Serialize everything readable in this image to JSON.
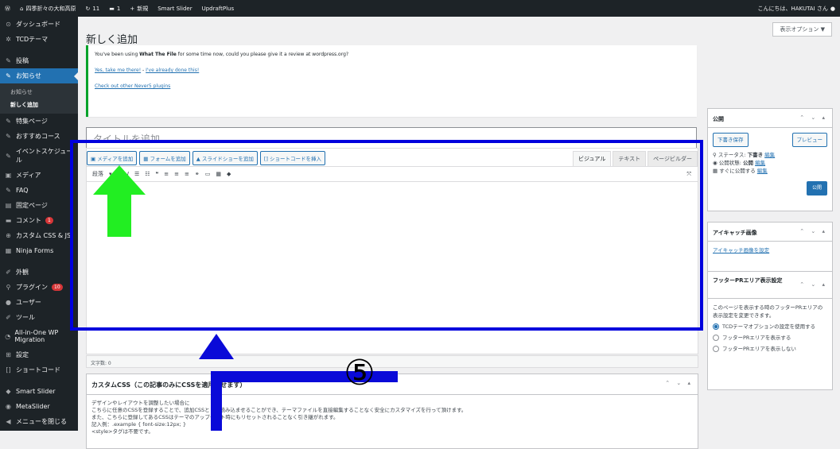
{
  "adminbar": {
    "site": "四季折々の大和高原",
    "comments": "11",
    "updates": "1",
    "new": "新規",
    "plugin1": "Smart Slider",
    "plugin2": "UpdraftPlus",
    "greeting": "こんにちは、HAKUTAI さん"
  },
  "sidebar": {
    "items": [
      {
        "label": "ダッシュボード",
        "icon": "dashboard-icon",
        "glyph": "⊙"
      },
      {
        "label": "TCDテーマ",
        "icon": "gear-icon",
        "glyph": "✲"
      },
      {
        "label": "投稿",
        "icon": "pin-icon",
        "glyph": "✎"
      },
      {
        "label": "お知らせ",
        "icon": "pin-icon",
        "glyph": "✎"
      },
      {
        "label": "特集ページ",
        "icon": "pin-icon",
        "glyph": "✎"
      },
      {
        "label": "おすすめコース",
        "icon": "pin-icon",
        "glyph": "✎"
      },
      {
        "label": "イベントスケジュール",
        "icon": "pin-icon",
        "glyph": "✎"
      },
      {
        "label": "メディア",
        "icon": "media-icon",
        "glyph": "▣"
      },
      {
        "label": "FAQ",
        "icon": "pin-icon",
        "glyph": "✎"
      },
      {
        "label": "固定ページ",
        "icon": "page-icon",
        "glyph": "▤"
      },
      {
        "label": "コメント",
        "icon": "comment-icon",
        "glyph": "▬",
        "badge": "1"
      },
      {
        "label": "カスタム CSS & JS",
        "icon": "plus-icon",
        "glyph": "⊕"
      },
      {
        "label": "Ninja Forms",
        "icon": "form-icon",
        "glyph": "▦"
      },
      {
        "label": "外観",
        "icon": "brush-icon",
        "glyph": "✐"
      },
      {
        "label": "プラグイン",
        "icon": "plugin-icon",
        "glyph": "⚲",
        "badge": "10"
      },
      {
        "label": "ユーザー",
        "icon": "user-icon",
        "glyph": "●"
      },
      {
        "label": "ツール",
        "icon": "wrench-icon",
        "glyph": "✐"
      },
      {
        "label": "All-in-One WP Migration",
        "icon": "migration-icon",
        "glyph": "◔"
      },
      {
        "label": "設定",
        "icon": "settings-icon",
        "glyph": "⊞"
      },
      {
        "label": "ショートコード",
        "icon": "bracket-icon",
        "glyph": "[]"
      },
      {
        "label": "Smart Slider",
        "icon": "slider-icon",
        "glyph": "◆"
      },
      {
        "label": "MetaSlider",
        "icon": "metaslider-icon",
        "glyph": "◉"
      },
      {
        "label": "メニューを閉じる",
        "icon": "collapse-icon",
        "glyph": "◀"
      }
    ],
    "sub": {
      "parent": "お知らせ",
      "current": "新しく追加"
    }
  },
  "page": {
    "title": "新しく追加",
    "screen_options": "表示オプション ▼"
  },
  "notice": {
    "line1a": "You've been using ",
    "line1b": "What The File",
    "line1c": " for some time now, could you please give it a review at wordpress.org?",
    "yes": "Yes, take me there!",
    "sep": " - ",
    "done": "I've already done this!",
    "other": "Check out other Never5 plugins"
  },
  "title_placeholder": "タイトルを追加",
  "editor": {
    "buttons": [
      "メディアを追加",
      "フォームを追加",
      "スライドショーを追加",
      "ショートコードを挿入"
    ],
    "tabs": [
      "ビジュアル",
      "テキスト",
      "ページビルダー"
    ],
    "format": "段落",
    "word_count": "文字数: 0"
  },
  "css_panel": {
    "title": "カスタムCSS（この記事のみにCSSを適用させます）",
    "l1": "デザインやレイアウトを調整したい場合に",
    "l2": "こちらに任意のCSSを登録することで、追加CSSとして読み込ませることができ、テーマファイルを直接編集することなく安全にカスタマイズを行って頂けます。",
    "l3": "また、こちらに登録してあるCSSはテーマのアップデート時にもリセットされることなく引き継がれます。",
    "l4": "記入例：.example { font-size:12px; }",
    "l5": "<style>タグは不要です。"
  },
  "publish": {
    "title": "公開",
    "save": "下書き保存",
    "preview": "プレビュー",
    "status": "ステータス: ",
    "status_val": "下書き",
    "visibility": "公開状態: ",
    "visibility_val": "公開",
    "schedule": "すぐに公開する",
    "edit": "編集",
    "publish_btn": "公開"
  },
  "featured": {
    "title": "アイキャッチ画像",
    "link": "アイキャッチ画像を設定"
  },
  "footer_pr": {
    "title": "フッターPRエリア表示設定",
    "desc": "このページを表示する時のフッターPRエリアの表示設定を変更できます。",
    "opts": [
      "TCDテーマオプションの設定を使用する",
      "フッターPRエリアを表示する",
      "フッターPRエリアを表示しない"
    ]
  },
  "annotation": {
    "step": "⑤"
  }
}
